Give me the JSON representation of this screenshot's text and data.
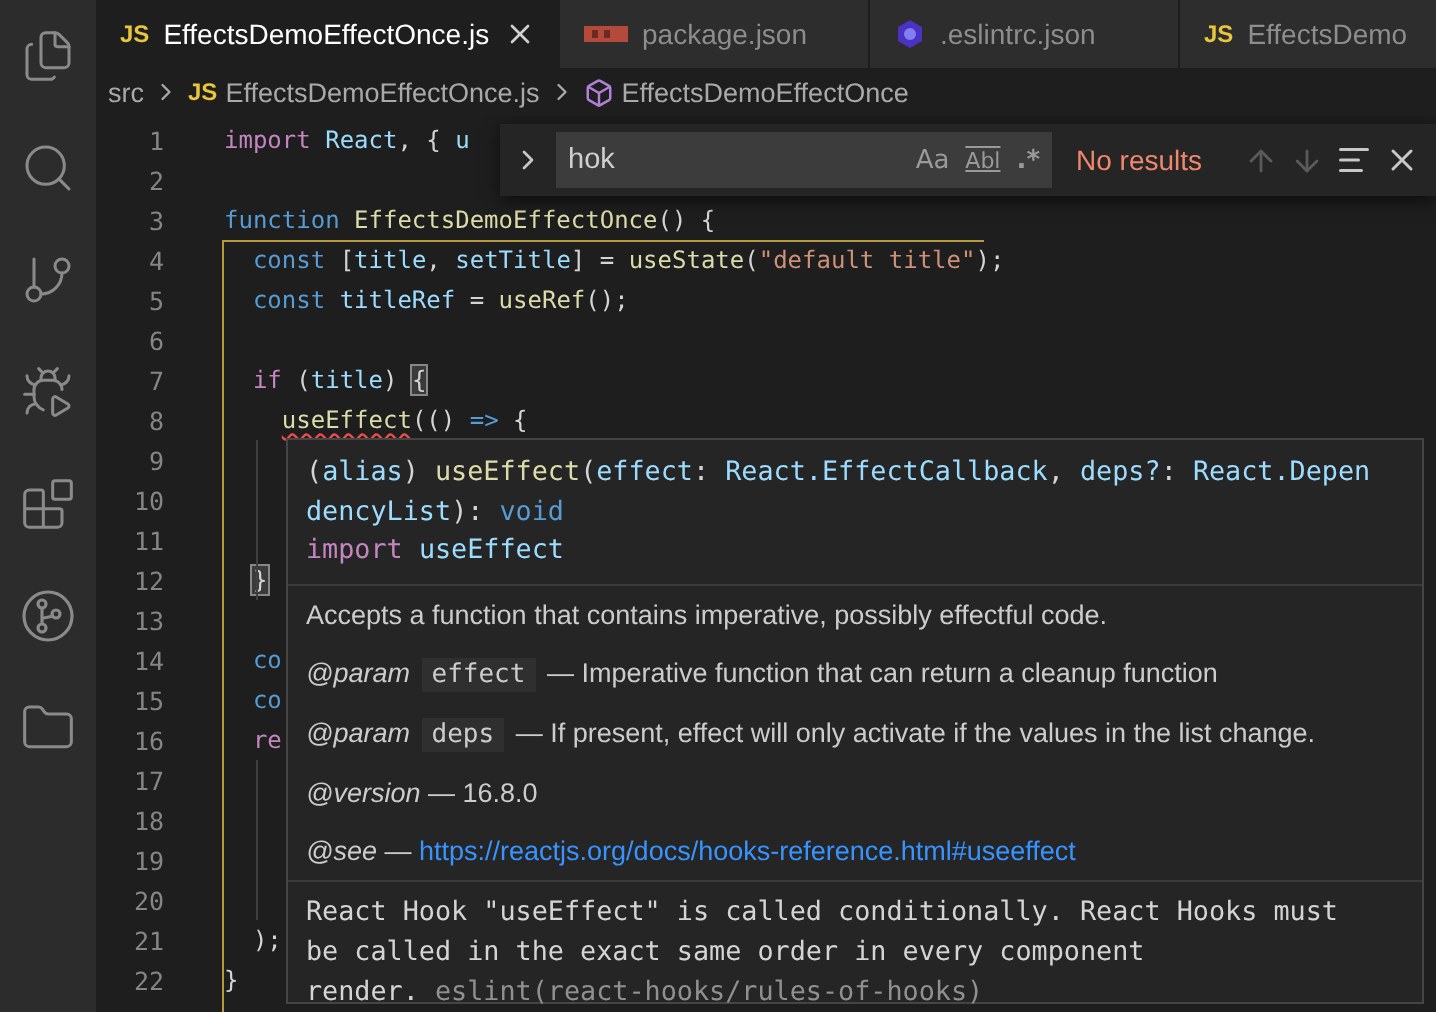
{
  "tabs": [
    {
      "label": "EffectsDemoEffectOnce.js",
      "kind": "js",
      "badge": "JS",
      "selected": true
    },
    {
      "label": "package.json",
      "kind": "npm",
      "selected": false
    },
    {
      "label": ".eslintrc.json",
      "kind": "eslint",
      "selected": false
    },
    {
      "label": "EffectsDemo",
      "kind": "js",
      "badge": "JS",
      "selected": false
    }
  ],
  "breadcrumb": [
    {
      "label": "src",
      "kind": "folder"
    },
    {
      "label": "EffectsDemoEffectOnce.js",
      "kind": "js",
      "badge": "JS"
    },
    {
      "label": "EffectsDemoEffectOnce",
      "kind": "symbol"
    }
  ],
  "editor": {
    "lines": [
      {
        "number": "1",
        "tokens": [
          {
            "text": "import",
            "kind": "kw"
          },
          {
            "text": " React",
            "kind": "var"
          },
          {
            "text": ", { ",
            "kind": "plain"
          },
          {
            "text": "u",
            "kind": "var"
          }
        ]
      },
      {
        "number": "2"
      },
      {
        "number": "3",
        "tokens": [
          {
            "text": "function ",
            "kind": "storage"
          },
          {
            "text": "EffectsDemoEffectOnce",
            "kind": "fn"
          },
          {
            "text": "() {",
            "kind": "plain"
          }
        ]
      },
      {
        "number": "4",
        "tokens": [
          {
            "text": "  const ",
            "kind": "storage"
          },
          {
            "text": "[",
            "kind": "plain"
          },
          {
            "text": "title",
            "kind": "var"
          },
          {
            "text": ", ",
            "kind": "plain"
          },
          {
            "text": "setTitle",
            "kind": "var"
          },
          {
            "text": "] = ",
            "kind": "plain"
          },
          {
            "text": "useState",
            "kind": "fn"
          },
          {
            "text": "(",
            "kind": "plain"
          },
          {
            "text": "\"default title\"",
            "kind": "str"
          },
          {
            "text": ");",
            "kind": "plain"
          }
        ]
      },
      {
        "number": "5",
        "tokens": [
          {
            "text": "  const ",
            "kind": "storage"
          },
          {
            "text": "titleRef",
            "kind": "var"
          },
          {
            "text": " = ",
            "kind": "plain"
          },
          {
            "text": "useRef",
            "kind": "fn"
          },
          {
            "text": "();",
            "kind": "plain"
          }
        ]
      },
      {
        "number": "6"
      },
      {
        "number": "7",
        "tokens": [
          {
            "text": "  if",
            "kind": "kw"
          },
          {
            "text": " (",
            "kind": "plain"
          },
          {
            "text": "title",
            "kind": "var"
          },
          {
            "text": ") ",
            "kind": "plain"
          },
          {
            "text": "{",
            "kind": "match"
          }
        ]
      },
      {
        "number": "8",
        "tokens": [
          {
            "text": "    useEffect",
            "kind": "error_fn"
          },
          {
            "text": "(() ",
            "kind": "plain"
          },
          {
            "text": "=>",
            "kind": "storage"
          },
          {
            "text": " {",
            "kind": "plain"
          }
        ]
      },
      {
        "number": "9"
      },
      {
        "number": "10"
      },
      {
        "number": "11"
      },
      {
        "number": "12",
        "tokens": [
          {
            "text": "  }",
            "kind": "match"
          }
        ]
      },
      {
        "number": "13"
      },
      {
        "number": "14",
        "tokens": [
          {
            "text": "  co",
            "kind": "storage"
          }
        ]
      },
      {
        "number": "15",
        "tokens": [
          {
            "text": "  co",
            "kind": "storage"
          }
        ]
      },
      {
        "number": "16",
        "tokens": [
          {
            "text": "  re",
            "kind": "kw"
          }
        ]
      },
      {
        "number": "17"
      },
      {
        "number": "18"
      },
      {
        "number": "19"
      },
      {
        "number": "20"
      },
      {
        "number": "21",
        "tokens": [
          {
            "text": "  );",
            "kind": "plain"
          }
        ]
      },
      {
        "number": "22",
        "tokens": [
          {
            "text": "}",
            "kind": "plain"
          }
        ]
      }
    ]
  },
  "find": {
    "query": "hok",
    "options": [
      {
        "label": "Aa",
        "kind": "case"
      },
      {
        "label": "Abl",
        "kind": "word"
      },
      {
        "label": ".*",
        "kind": "regex"
      }
    ],
    "status": "No results",
    "nav": [
      {
        "kind": "up",
        "disabled": true
      },
      {
        "kind": "down",
        "disabled": true
      }
    ]
  },
  "hover": {
    "signature": [
      [
        {
          "text": "(",
          "kind": "plain"
        },
        {
          "text": "alias",
          "kind": "var"
        },
        {
          "text": ") ",
          "kind": "plain"
        },
        {
          "text": "useEffect",
          "kind": "fn"
        },
        {
          "text": "(",
          "kind": "plain"
        },
        {
          "text": "effect",
          "kind": "var"
        },
        {
          "text": ": ",
          "kind": "plain"
        },
        {
          "text": "React.EffectCallback",
          "kind": "var"
        },
        {
          "text": ", ",
          "kind": "plain"
        },
        {
          "text": "deps?",
          "kind": "var"
        },
        {
          "text": ": ",
          "kind": "plain"
        },
        {
          "text": "React.Depen",
          "kind": "var"
        }
      ],
      [
        {
          "text": "dencyList",
          "kind": "var"
        },
        {
          "text": "): ",
          "kind": "plain"
        },
        {
          "text": "void",
          "kind": "storage"
        }
      ],
      [
        {
          "text": "import",
          "kind": "kw"
        },
        {
          "text": " useEffect",
          "kind": "var"
        }
      ]
    ],
    "description": "Accepts a function that contains imperative, possibly effectful code.",
    "tags": [
      {
        "tag": "@param",
        "name": "effect",
        "text": "— Imperative function that can return a cleanup function"
      },
      {
        "tag": "@param",
        "name": "deps",
        "text": "— If present, effect will only activate if the values in the list change."
      },
      {
        "tag": "@version",
        "text": "— 16.8.0"
      },
      {
        "tag": "@see",
        "text": "—",
        "link": "https://reactjs.org/docs/hooks-reference.html#useeffect"
      }
    ],
    "problem": {
      "lines": [
        "React Hook \"useEffect\" is called conditionally. React Hooks must",
        "be called in the exact same order in every component",
        "render."
      ],
      "source": "eslint(react-hooks/rules-of-hooks)"
    }
  }
}
